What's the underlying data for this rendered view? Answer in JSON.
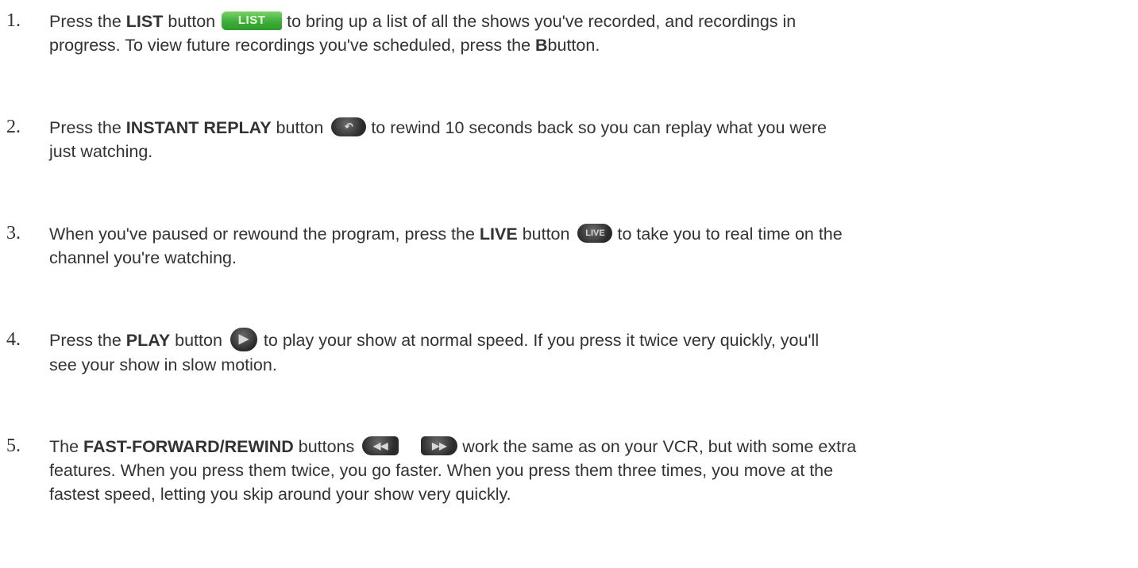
{
  "steps": [
    {
      "number": "1.",
      "t1": "Press the ",
      "b1": "LIST",
      "t2": " button",
      "icon_label": "LIST",
      "t3": "to bring up a list of all the shows you've recorded, and recordings in",
      "line2a": "progress. To view future recordings you've scheduled, press the ",
      "line2b": "B",
      "line2c": "button."
    },
    {
      "number": "2.",
      "t1": "Press the ",
      "b1": "INSTANT REPLAY",
      "t2": " button",
      "t3": "to rewind 10 seconds back so you can replay what you were",
      "line2": "just watching."
    },
    {
      "number": "3.",
      "t1": "When you've paused or rewound the program, press the ",
      "b1": "LIVE",
      "t2": " button",
      "icon_label": "LIVE",
      "t3": "to take you to real time on the",
      "line2": "channel you're watching."
    },
    {
      "number": "4.",
      "t1": "Press the ",
      "b1": "PLAY",
      "t2": " button",
      "t3": "to play your show at normal speed. If you press it twice very quickly, you'll",
      "line2": "see your show in slow motion."
    },
    {
      "number": "5.",
      "t1": "The ",
      "b1": "FAST-FORWARD/REWIND",
      "t2": " buttons",
      "t3": "work the same as on your VCR, but with some extra",
      "line2": "features. When you press them twice, you go faster. When you press them three times, you move at the",
      "line3": "fastest speed, letting you skip around your show very quickly."
    }
  ]
}
